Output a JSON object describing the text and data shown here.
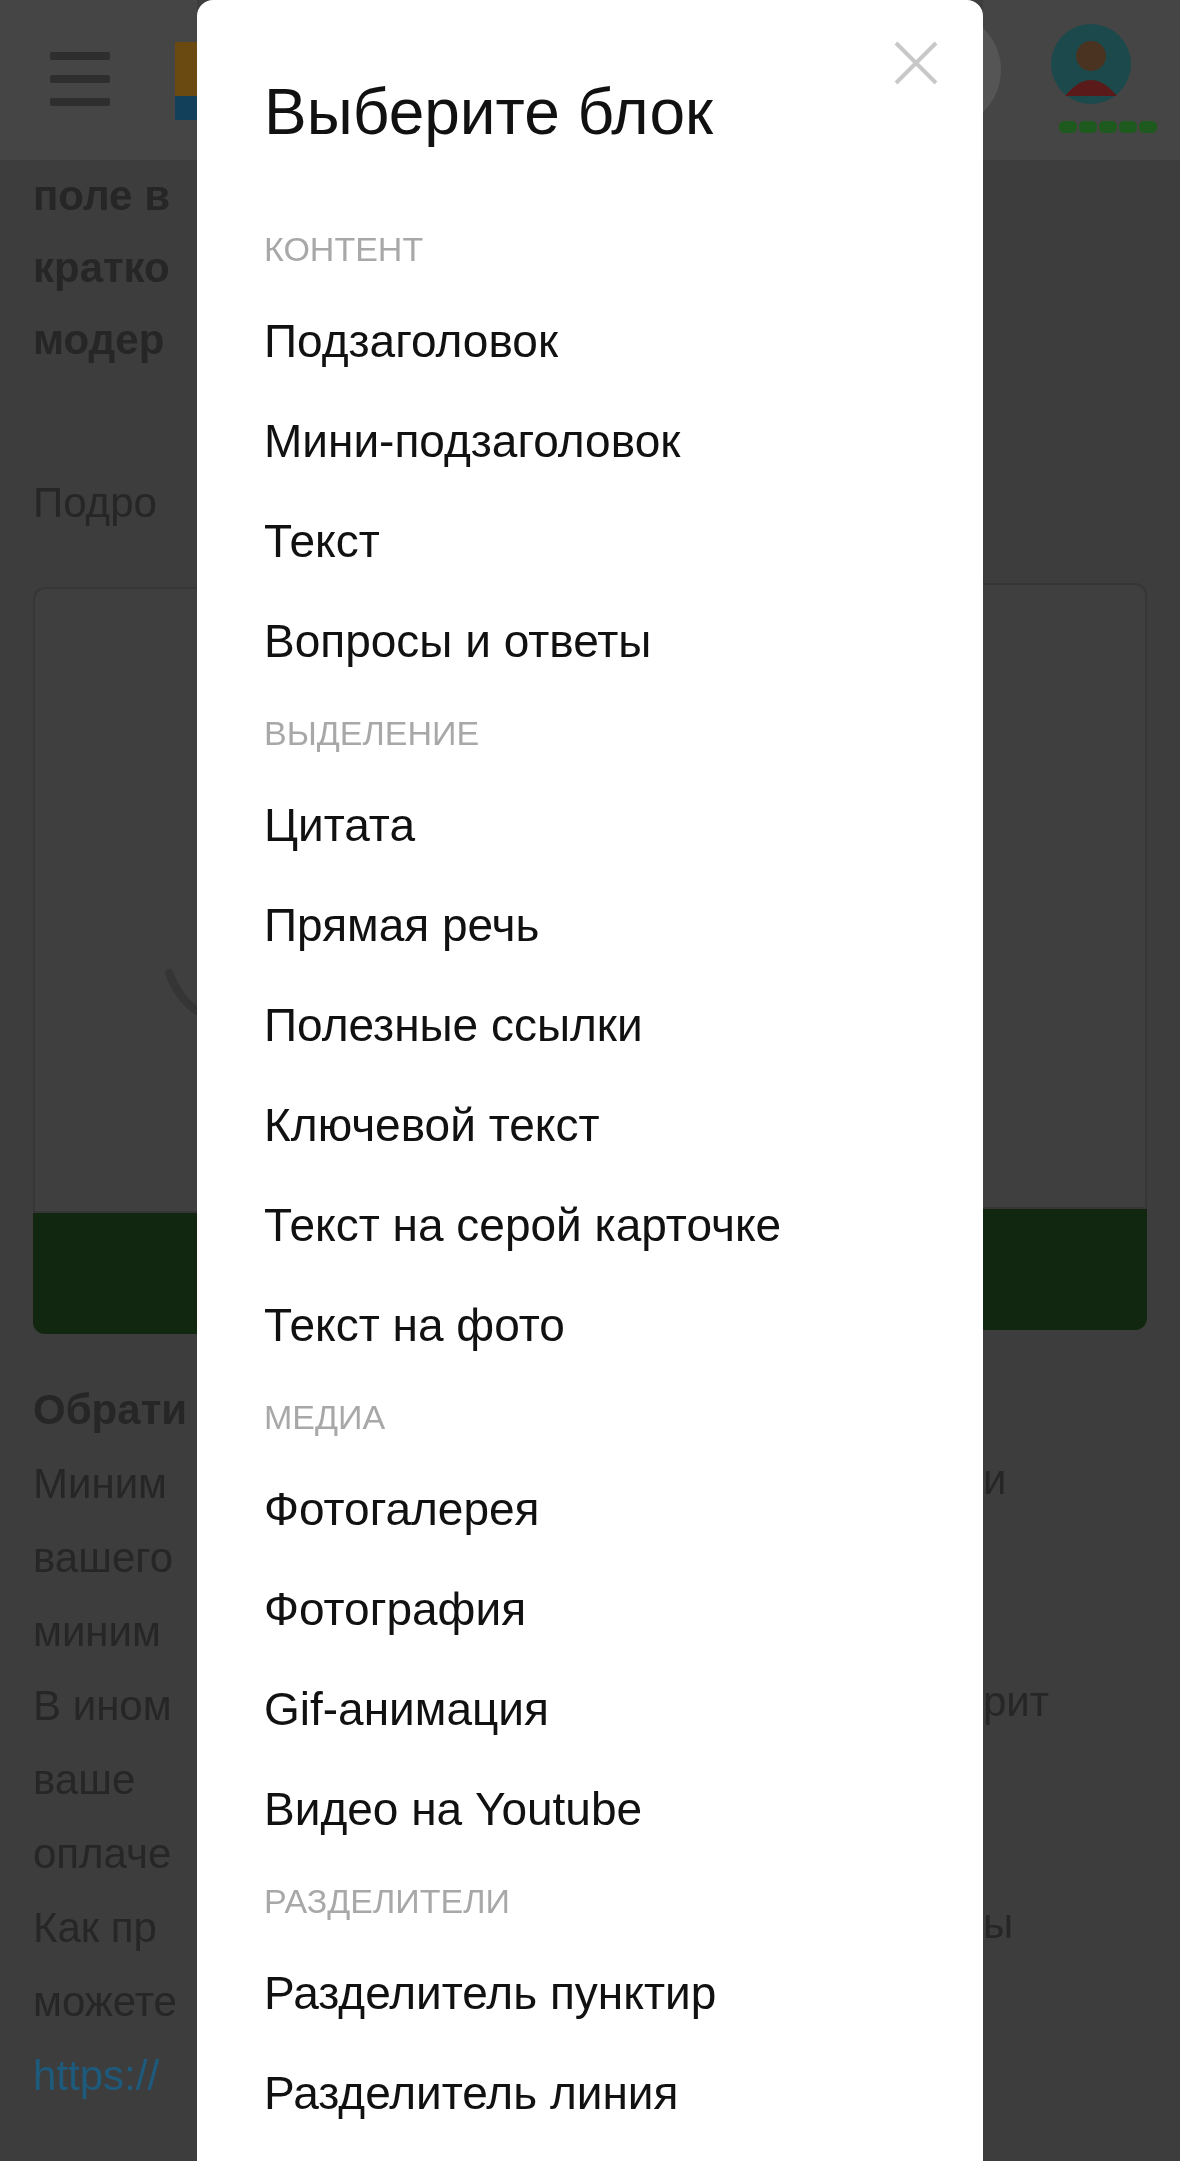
{
  "page_behind": {
    "intro_lines": [
      "поле в",
      "кратко",
      "модер"
    ],
    "label": "Подро",
    "note_title": "Обрати",
    "note_lines": [
      {
        "left": "Миним",
        "right": "и"
      },
      {
        "left": "вашего"
      },
      {
        "left": "миним"
      },
      {
        "left": "В ином",
        "right": "рит"
      },
      {
        "left": "ваше"
      },
      {
        "left": "оплаче"
      },
      {
        "left": "Как пр",
        "right": "ы"
      },
      {
        "left": "можете"
      }
    ],
    "link": "https://"
  },
  "modal": {
    "title": "Выберите блок",
    "sections": [
      {
        "heading": "КОНТЕНТ",
        "items": [
          "Подзаголовок",
          "Мини-подзаголовок",
          "Текст",
          "Вопросы и ответы"
        ]
      },
      {
        "heading": "ВЫДЕЛЕНИЕ",
        "items": [
          "Цитата",
          "Прямая речь",
          "Полезные ссылки",
          "Ключевой текст",
          "Текст на серой карточке",
          "Текст на фото"
        ]
      },
      {
        "heading": "МЕДИА",
        "items": [
          "Фотогалерея",
          "Фотография",
          "Gif-анимация",
          "Видео на Youtube"
        ]
      },
      {
        "heading": "РАЗДЕЛИТЕЛИ",
        "items": [
          "Разделитель пунктир",
          "Разделитель линия"
        ]
      }
    ]
  }
}
